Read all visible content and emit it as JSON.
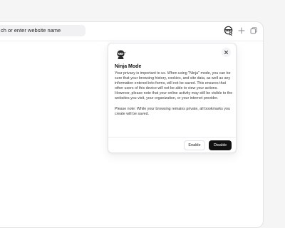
{
  "toolbar": {
    "address_text": "ch or enter website name",
    "icons": [
      "ninja-mode-icon",
      "new-tab-icon",
      "tabs-overview-icon"
    ]
  },
  "popover": {
    "title": "Ninja Mode",
    "body": "Your privacy is important to us. When using \"Ninja\" mode, you can be sure that your browsing history, cookies, and site data, as well as any information entered into forms, will not be saved. This ensures that other users of this device will not be able to view your actions.",
    "body_continued": "However, please note that your online activity may still be visible to the websites you visit, your organization, or your internet provider.",
    "note": "Please note: While your browsing remains private, all bookmarks you create will be saved.",
    "enable_label": "Enable",
    "disable_label": "Disable"
  },
  "colors": {
    "primary_button": "#111111",
    "background": "#f5f5f6"
  }
}
